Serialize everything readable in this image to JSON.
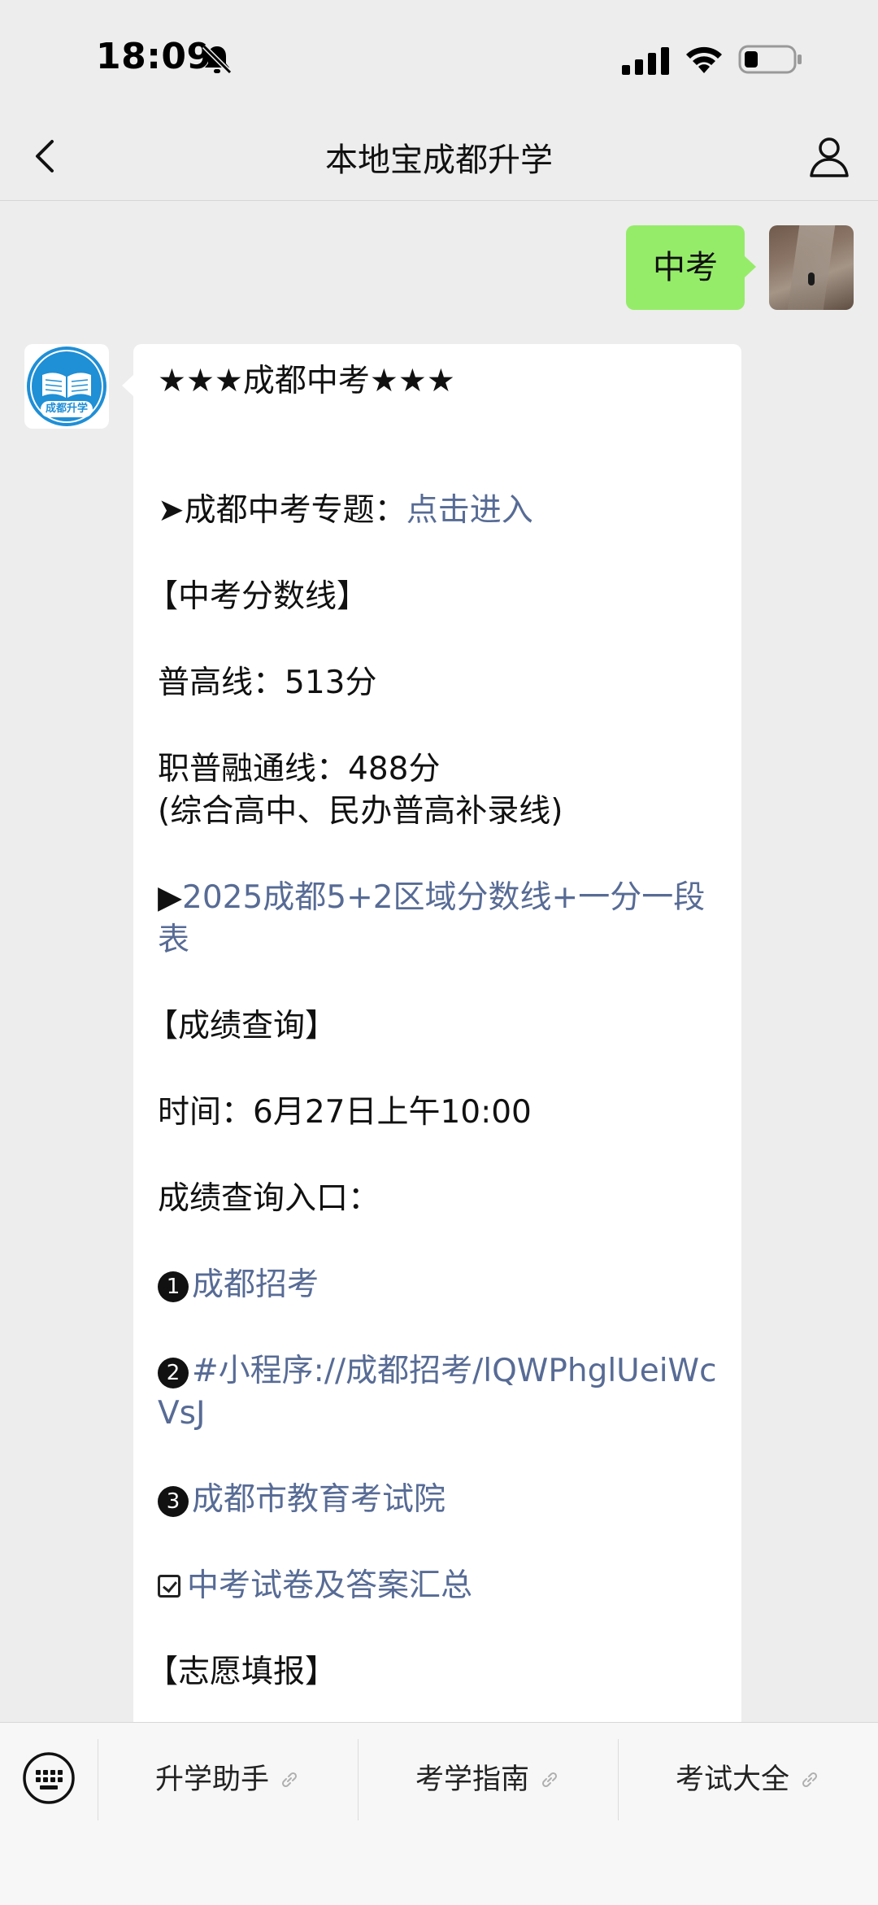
{
  "status_bar": {
    "time": "18:09",
    "icons": [
      "bell-muted-icon",
      "signal-icon",
      "wifi-icon",
      "battery-icon"
    ]
  },
  "nav": {
    "title": "本地宝成都升学",
    "back_icon": "chevron-left-icon",
    "profile_icon": "person-icon"
  },
  "outgoing": {
    "text": "中考"
  },
  "incoming": {
    "avatar_text": "成都升学",
    "title": "★★★成都中考★★★",
    "special_prefix": "➤成都中考专题：",
    "special_link": "点击进入",
    "section_score": "【中考分数线】",
    "pugao": "普高线：513分",
    "zhipu": "职普融通线：488分",
    "zhipu_note": "(综合高中、民办普高补录线)",
    "link_2025_prefix": "▶",
    "link_2025": "2025成都5+2区域分数线+一分一段表",
    "section_query": "【成绩查询】",
    "time_line": "时间：6月27日上午10:00",
    "entry_label": "成绩查询入口：",
    "entry_1_num": "1",
    "entry_1": "成都招考",
    "entry_2_num": "2",
    "entry_2": "#小程序://成都招考/lQWPhglUeiWcVsJ",
    "entry_3_num": "3",
    "entry_3": "成都市教育考试院",
    "papers_link": "中考试卷及答案汇总",
    "section_volunteer": "【志愿填报】"
  },
  "bottom_menu": {
    "keyboard_icon": "keyboard-icon",
    "items": [
      {
        "label": "升学助手"
      },
      {
        "label": "考学指南"
      },
      {
        "label": "考试大全"
      }
    ]
  },
  "colors": {
    "background": "#ededed",
    "outgoing_bubble": "#95ec69",
    "link": "#576b95",
    "avatar_blue": "#1f8fd6"
  }
}
